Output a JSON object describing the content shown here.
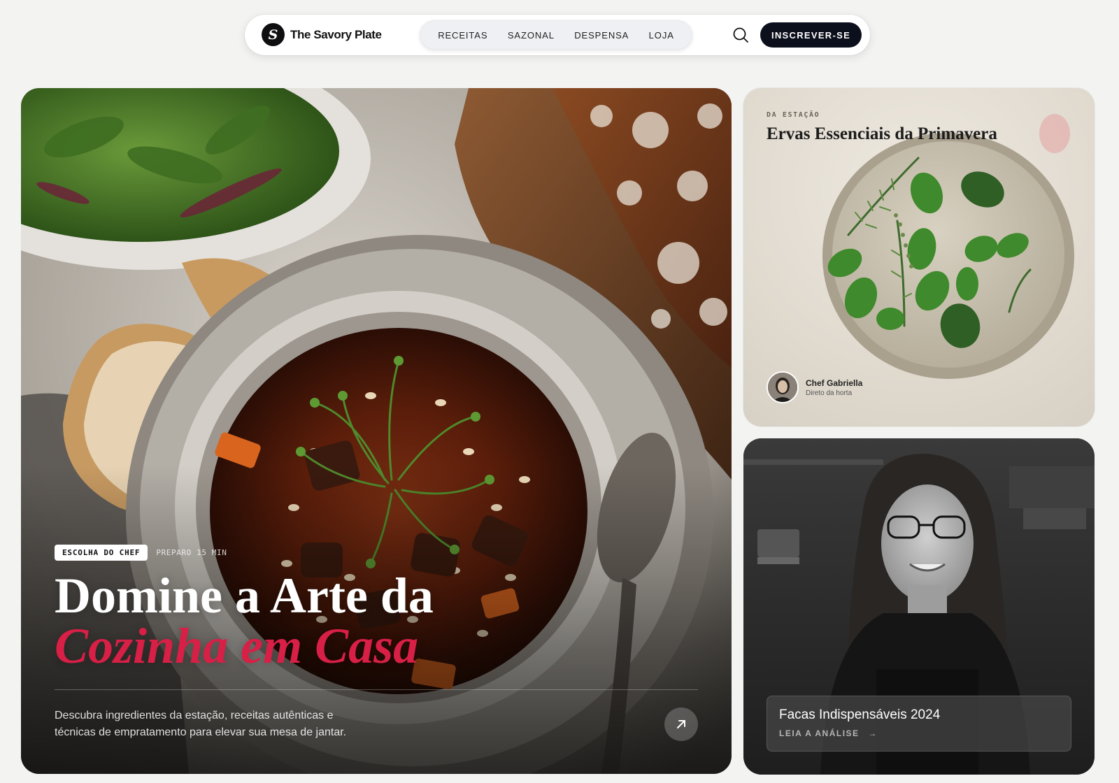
{
  "brand": {
    "mark": "S",
    "name": "The Savory Plate"
  },
  "nav": {
    "links": [
      "RECEITAS",
      "SAZONAL",
      "DESPENSA",
      "LOJA"
    ],
    "subscribe_label": "INSCREVER-SE"
  },
  "hero": {
    "badge": "ESCOLHA DO CHEF",
    "meta": "PREPARO 15 MIN",
    "title_line1": "Domine a Arte da",
    "title_line2": "Cozinha em Casa",
    "description": "Descubra ingredientes da estação, receitas autênticas e técnicas de empratamento para elevar sua mesa de jantar."
  },
  "herbs_card": {
    "eyebrow": "DA ESTAÇÃO",
    "title": "Ervas Essenciais da Primavera",
    "chef_name": "Chef Gabriella",
    "chef_subtitle": "Direto da horta"
  },
  "knives_card": {
    "title": "Facas Indispensáveis 2024",
    "link_label": "LEIA A ANÁLISE",
    "link_arrow": "→"
  },
  "colors": {
    "accent": "#d81f46",
    "dark": "#0c0f1c"
  },
  "icons": {
    "search": "search-icon",
    "arrow": "arrow-up-right-icon"
  }
}
